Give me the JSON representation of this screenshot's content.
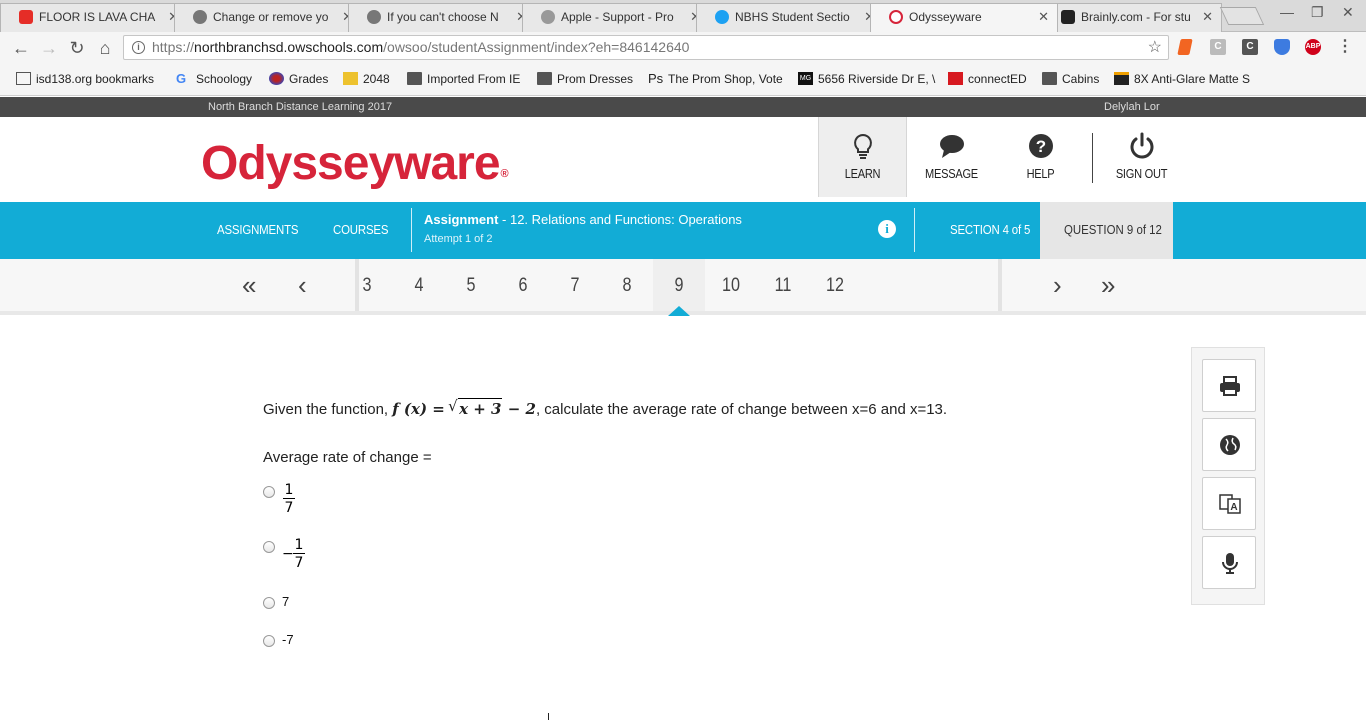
{
  "browser": {
    "tabs": [
      {
        "title": "FLOOR IS LAVA CHA",
        "icon": "youtube-icon"
      },
      {
        "title": "Change or remove yo",
        "icon": "apple-icon"
      },
      {
        "title": "If you can't choose N",
        "icon": "apple-icon"
      },
      {
        "title": "Apple - Support - Pro",
        "icon": "apple-icon"
      },
      {
        "title": "NBHS Student Sectio",
        "icon": "twitter-icon"
      },
      {
        "title": "Odysseyware",
        "icon": "odysseyware-icon",
        "active": true
      },
      {
        "title": "Brainly.com - For stu",
        "icon": "brainly-icon"
      }
    ],
    "close_glyph": "✕",
    "url_prefix": "https://",
    "url_host": "northbranchsd.owschools.com",
    "url_path": "/owsoo/studentAssignment/index?eh=846142640",
    "bookmarks": [
      {
        "label": "isd138.org bookmarks",
        "icon": "apps-icon"
      },
      {
        "label": "Schoology",
        "icon": "google-icon"
      },
      {
        "label": "Grades",
        "icon": "grades-icon"
      },
      {
        "label": "2048",
        "icon": "2048-icon"
      },
      {
        "label": "Imported From IE",
        "icon": "folder-icon"
      },
      {
        "label": "Prom Dresses",
        "icon": "folder-icon"
      },
      {
        "label": "The Prom Shop, Vote",
        "icon": "promshop-icon"
      },
      {
        "label": "5656 Riverside Dr E, \\",
        "icon": "mg-icon"
      },
      {
        "label": "connectED",
        "icon": "connected-icon"
      },
      {
        "label": "Cabins",
        "icon": "folder-icon"
      },
      {
        "label": "8X Anti-Glare Matte S",
        "icon": "shop-icon"
      }
    ],
    "extension_labels": {
      "c1": "C",
      "c2": "C",
      "abp": "ABP"
    }
  },
  "site": {
    "top_left": "North Branch Distance Learning 2017",
    "user_name": "Delylah Lor",
    "logo_text": "Odysseyware",
    "logo_mark": "®",
    "header_buttons": [
      {
        "label": "LEARN",
        "icon": "lightbulb-icon"
      },
      {
        "label": "MESSAGE",
        "icon": "chat-bubble-icon"
      },
      {
        "label": "HELP",
        "icon": "question-circle-icon"
      },
      {
        "label": "SIGN OUT",
        "icon": "power-icon"
      }
    ]
  },
  "nav": {
    "assignments": "ASSIGNMENTS",
    "courses": "COURSES",
    "assignment_label": "Assignment",
    "assignment_name": " - 12. Relations and Functions: Operations",
    "attempt": "Attempt 1 of 2",
    "section": "SECTION 4 of 5",
    "question": "QUESTION 9 of 12"
  },
  "pager": {
    "pages": [
      "3",
      "4",
      "5",
      "6",
      "7",
      "8",
      "9",
      "10",
      "11",
      "12"
    ],
    "current": "9"
  },
  "question": {
    "prefix": "Given the function, ",
    "func_lhs": "f (x) = ",
    "radicand": "x + 3",
    "func_rhs": " − 2",
    "suffix": ", calculate the average rate of change between x=6 and x=13.",
    "prompt": "Average rate of change =",
    "choices": [
      {
        "num": "1",
        "den": "7",
        "sign": ""
      },
      {
        "num": "1",
        "den": "7",
        "sign": "−"
      },
      {
        "text": "7"
      },
      {
        "text": "-7"
      }
    ]
  },
  "tools": [
    {
      "icon": "printer-icon"
    },
    {
      "icon": "globe-icon"
    },
    {
      "icon": "translate-icon"
    },
    {
      "icon": "microphone-icon"
    }
  ],
  "colors": {
    "brand_red": "#d6243a",
    "nav_blue": "#12acd6",
    "topbar_gray": "#4a4a4a"
  }
}
